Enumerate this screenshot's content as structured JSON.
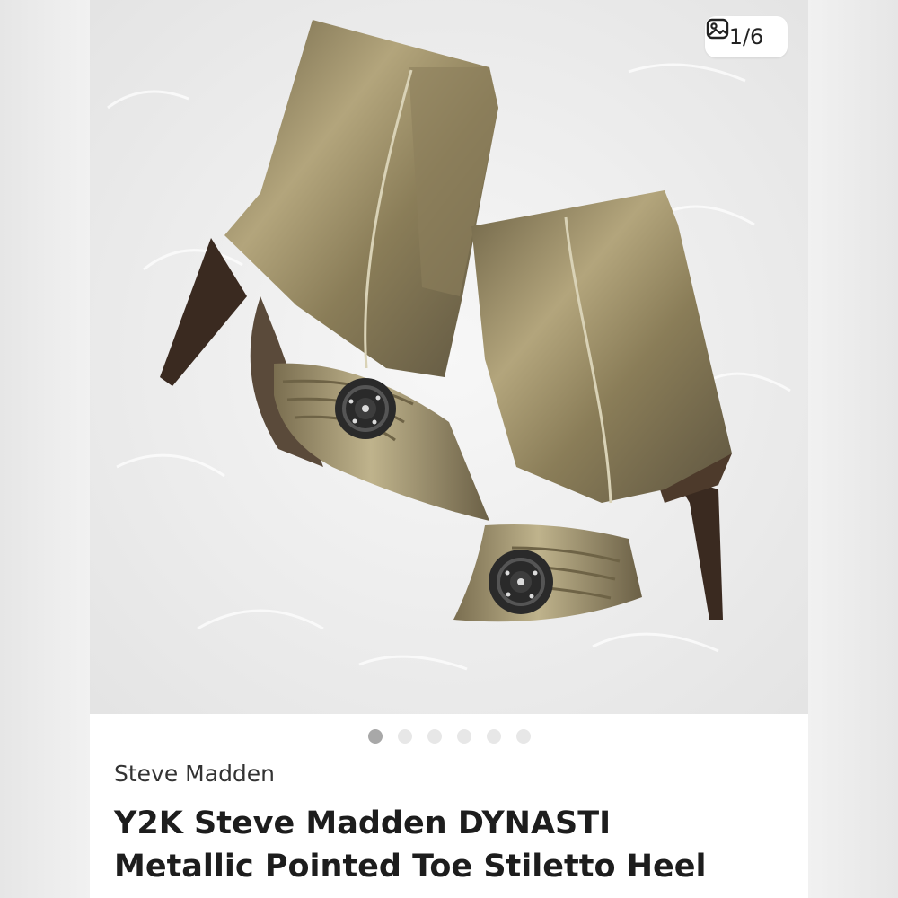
{
  "listing": {
    "image_counter": "1/6",
    "image_alt": "Pair of metallic gold pointed-toe stiletto heel boots with black flower embellishment on white faux fur",
    "carousel": {
      "total": 6,
      "active_index": 0
    },
    "brand": "Steve Madden",
    "title_line1": "Y2K Steve Madden DYNASTI",
    "title_line2": "Metallic Pointed Toe Stiletto Heel"
  },
  "colors": {
    "dot_active": "#a8a8a8",
    "dot_inactive": "#e7e7e7",
    "boot_metallic": "#9a8c66",
    "heel": "#3a2a20"
  },
  "icons": {
    "counter": "image-gallery-icon"
  }
}
